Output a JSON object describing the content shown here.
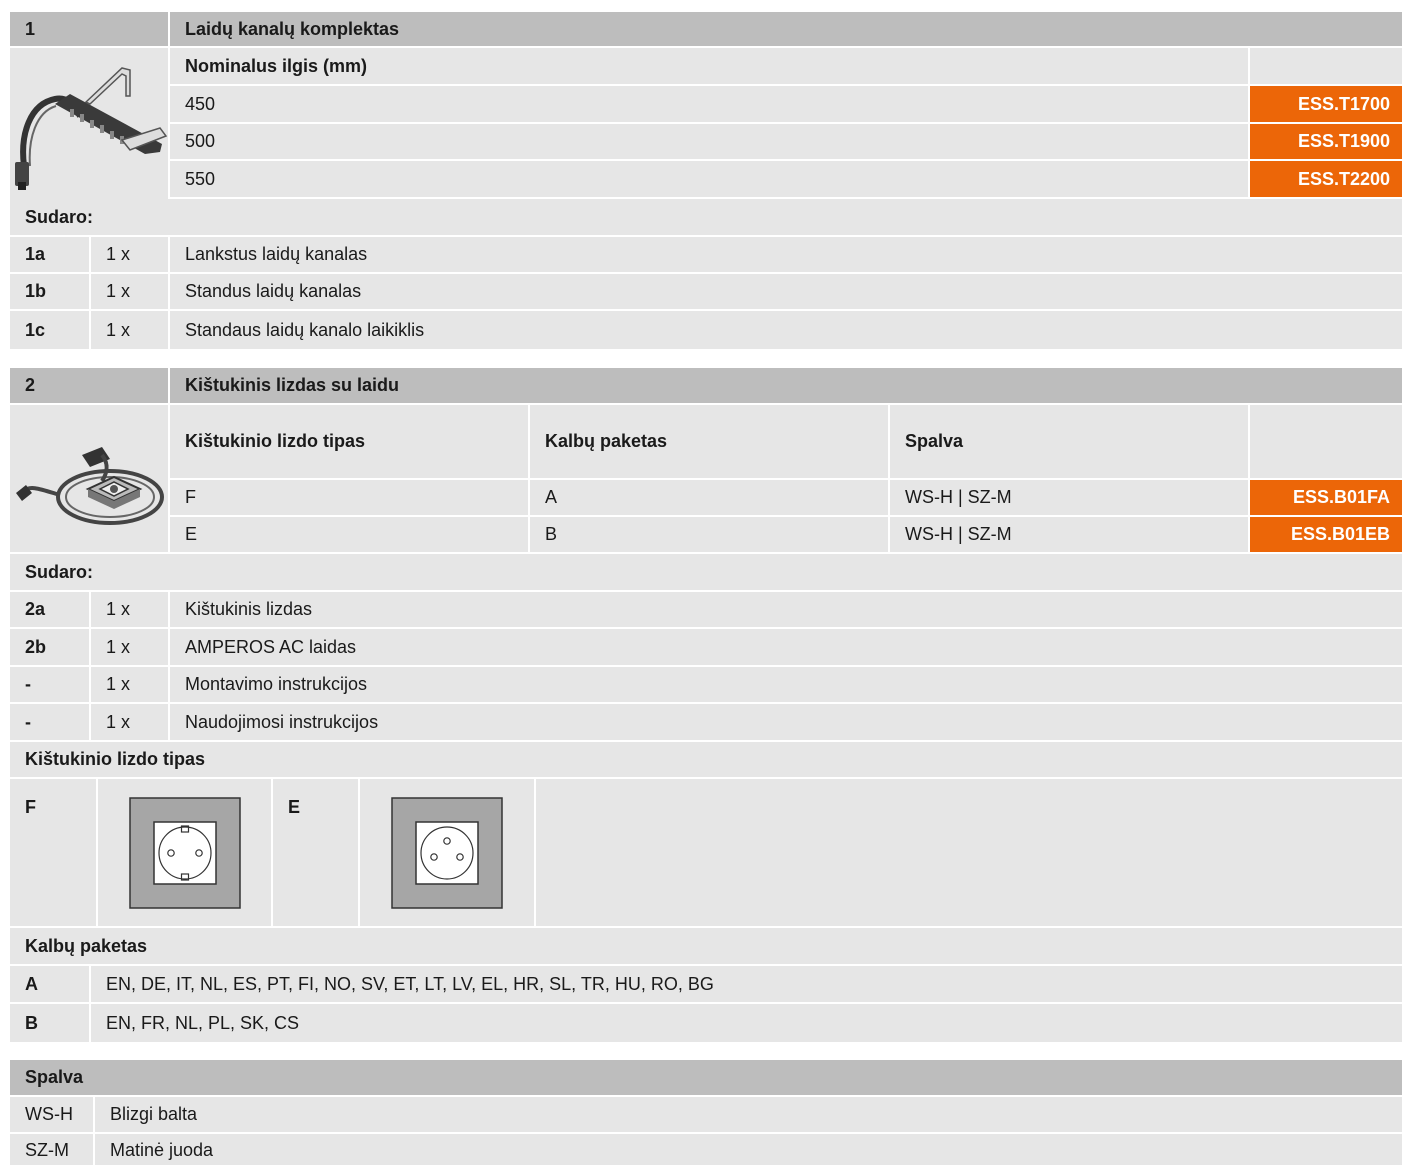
{
  "section1": {
    "number": "1",
    "title": "Laidų kanalų komplektas",
    "image_icon": "cable-chain-icon",
    "column_header": "Nominalus ilgis (mm)",
    "rows": [
      {
        "length": "450",
        "code": "ESS.T1700"
      },
      {
        "length": "500",
        "code": "ESS.T1900"
      },
      {
        "length": "550",
        "code": "ESS.T2200"
      }
    ],
    "contents_label": "Sudaro:",
    "contents": [
      {
        "id": "1a",
        "qty": "1 x",
        "desc": "Lankstus laidų kanalas"
      },
      {
        "id": "1b",
        "qty": "1 x",
        "desc": "Standus laidų kanalas"
      },
      {
        "id": "1c",
        "qty": "1 x",
        "desc": "Standaus laidų kanalo laikiklis"
      }
    ]
  },
  "section2": {
    "number": "2",
    "title": "Kištukinis lizdas su laidu",
    "image_icon": "socket-with-cable-icon",
    "headers": [
      "Kištukinio lizdo tipas",
      "Kalbų paketas",
      "Spalva"
    ],
    "rows": [
      {
        "type": "F",
        "lang": "A",
        "color": "WS-H | SZ-M",
        "code": "ESS.B01FA"
      },
      {
        "type": "E",
        "lang": "B",
        "color": "WS-H | SZ-M",
        "code": "ESS.B01EB"
      }
    ],
    "contents_label": "Sudaro:",
    "contents": [
      {
        "id": "2a",
        "qty": "1 x",
        "desc": "Kištukinis lizdas"
      },
      {
        "id": "2b",
        "qty": "1 x",
        "desc": "AMPEROS AC laidas"
      },
      {
        "id": "-",
        "qty": "1 x",
        "desc": "Montavimo instrukcijos"
      },
      {
        "id": "-",
        "qty": "1 x",
        "desc": "Naudojimosi instrukcijos"
      }
    ],
    "socket_types_label": "Kištukinio lizdo tipas",
    "socket_types": [
      {
        "label": "F",
        "icon": "schuko-socket-icon"
      },
      {
        "label": "E",
        "icon": "french-socket-icon"
      }
    ],
    "lang_label": "Kalbų paketas",
    "lang_packages": [
      {
        "id": "A",
        "langs": "EN, DE, IT, NL, ES, PT, FI, NO, SV, ET, LT, LV, EL, HR, SL, TR, HU, RO, BG"
      },
      {
        "id": "B",
        "langs": "EN, FR, NL, PL, SK, CS"
      }
    ]
  },
  "colors_section": {
    "title": "Spalva",
    "rows": [
      {
        "code": "WS-H",
        "name": "Blizgi balta"
      },
      {
        "code": "SZ-M",
        "name": "Matinė juoda"
      }
    ]
  },
  "accent": "#ec6608"
}
